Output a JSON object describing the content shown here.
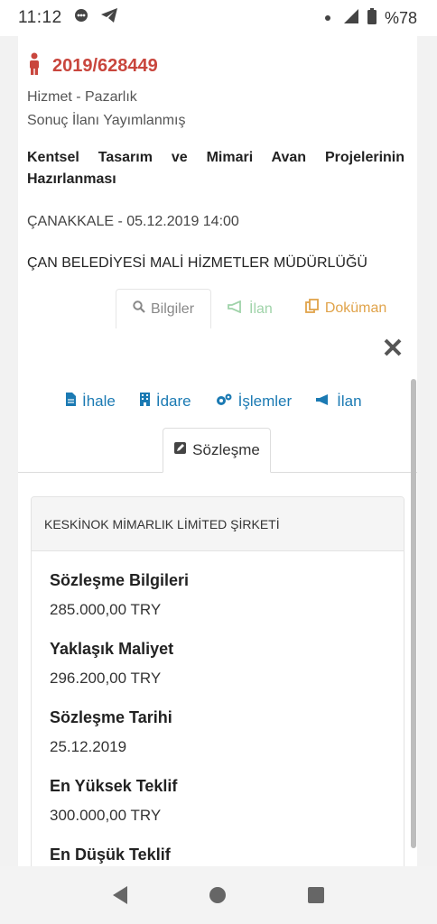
{
  "status": {
    "time": "11:12",
    "battery": "%78"
  },
  "tender": {
    "id": "2019/628449",
    "type": "Hizmet - Pazarlık",
    "state": "Sonuç İlanı Yayımlanmış",
    "title": "Kentsel Tasarım ve Mimari Avan Projelerinin Hazırlanması",
    "place_date": "ÇANAKKALE - 05.12.2019 14:00",
    "authority": "ÇAN BELEDİYESİ MALİ HİZMETLER MÜDÜRLÜĞÜ"
  },
  "top_tabs": {
    "bilgiler": "Bilgiler",
    "ilan": "İlan",
    "dokuman": "Doküman"
  },
  "sub_nav": {
    "ihale": "İhale",
    "idare": "İdare",
    "islemler": "İşlemler",
    "ilan": "İlan",
    "sozlesme": "Sözleşme"
  },
  "contract": {
    "company": "KESKİNOK MİMARLIK LİMİTED ŞİRKETİ",
    "fields": [
      {
        "label": "Sözleşme Bilgileri",
        "value": "285.000,00 TRY"
      },
      {
        "label": "Yaklaşık Maliyet",
        "value": "296.200,00 TRY"
      },
      {
        "label": "Sözleşme Tarihi",
        "value": "25.12.2019"
      },
      {
        "label": "En Yüksek Teklif",
        "value": "300.000,00 TRY"
      },
      {
        "label": "En Düşük Teklif",
        "value": ""
      }
    ]
  },
  "colors": {
    "accent_red": "#c9463d",
    "link_blue": "#1b7ab3",
    "ilan_green": "#9fd3a9",
    "doc_orange": "#e0a34a"
  }
}
